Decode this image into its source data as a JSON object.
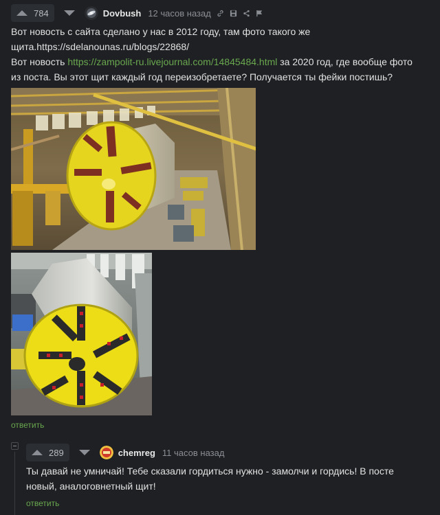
{
  "comment1": {
    "rating": "784",
    "author": "Dovbush",
    "time": "12 часов назад",
    "text_line1": "Вот новость с сайта сделано у нас в 2012 году, там фото такого же щита.https://sdelanounas.ru/blogs/22868/",
    "text_line2_prefix": "Вот новость ",
    "text_line2_link": "https://zampolit-ru.livejournal.com/14845484.html",
    "text_line2_suffix": " за 2020 год, где вообще фото из поста. Вы этот щит каждый год переизобретаете? Получается ты фейки постишь?",
    "reply_label": "ответить",
    "tool_icons": [
      "link-icon",
      "save-icon",
      "share-icon",
      "flag-icon"
    ]
  },
  "comment2": {
    "rating": "289",
    "author": "chemreg",
    "time": "11 часов назад",
    "text": "Ты давай не умничай! Тебе сказали гордиться нужно - замолчи и гордись! В посте новый, аналоговнетный щит!",
    "reply_label": "ответить"
  },
  "colors": {
    "background": "#1e2023",
    "link": "#6aa84f",
    "muted": "#8b8f95",
    "shield_yellow": "#e8d61c"
  }
}
